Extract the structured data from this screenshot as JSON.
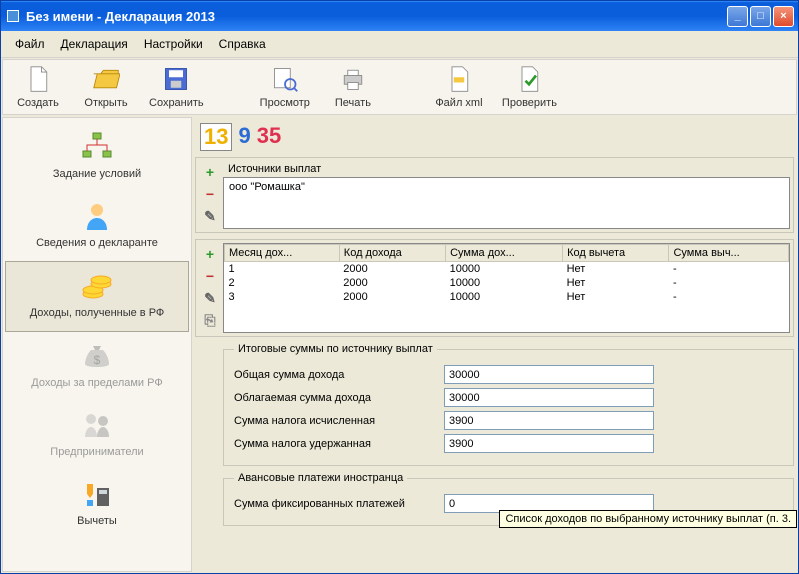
{
  "window": {
    "title": "Без имени - Декларация 2013"
  },
  "menu": {
    "file": "Файл",
    "declaration": "Декларация",
    "settings": "Настройки",
    "help": "Справка"
  },
  "toolbar": {
    "create": "Создать",
    "open": "Открыть",
    "save": "Сохранить",
    "preview": "Просмотр",
    "print": "Печать",
    "filexml": "Файл xml",
    "check": "Проверить"
  },
  "sidebar": {
    "conditions": "Задание условий",
    "declarant": "Сведения о декларанте",
    "income_rf": "Доходы, полученные в РФ",
    "income_abroad": "Доходы за пределами РФ",
    "entrepreneurs": "Предприниматели",
    "deductions": "Вычеты"
  },
  "rates": {
    "r13": "13",
    "r9": "9",
    "r35": "35"
  },
  "sources": {
    "title": "Источники выплат",
    "items": [
      "ооо \"Ромашка\""
    ]
  },
  "tooltip": "Список доходов по выбранному источнику выплат (п. 3.",
  "income_table": {
    "columns": [
      "Месяц дох...",
      "Код дохода",
      "Сумма дох...",
      "Код вычета",
      "Сумма выч..."
    ],
    "rows": [
      {
        "month": "1",
        "code": "2000",
        "sum": "10000",
        "dcode": "Нет",
        "dsum": "-"
      },
      {
        "month": "2",
        "code": "2000",
        "sum": "10000",
        "dcode": "Нет",
        "dsum": "-"
      },
      {
        "month": "3",
        "code": "2000",
        "sum": "10000",
        "dcode": "Нет",
        "dsum": "-"
      }
    ]
  },
  "totals": {
    "legend": "Итоговые суммы по источнику выплат",
    "total_label": "Общая сумма дохода",
    "total_value": "30000",
    "taxable_label": "Облагаемая сумма дохода",
    "taxable_value": "30000",
    "calc_label": "Сумма налога исчисленная",
    "calc_value": "3900",
    "withheld_label": "Сумма налога удержанная",
    "withheld_value": "3900"
  },
  "advance": {
    "legend": "Авансовые платежи иностранца",
    "fixed_label": "Сумма фиксированных платежей",
    "fixed_value": "0"
  }
}
